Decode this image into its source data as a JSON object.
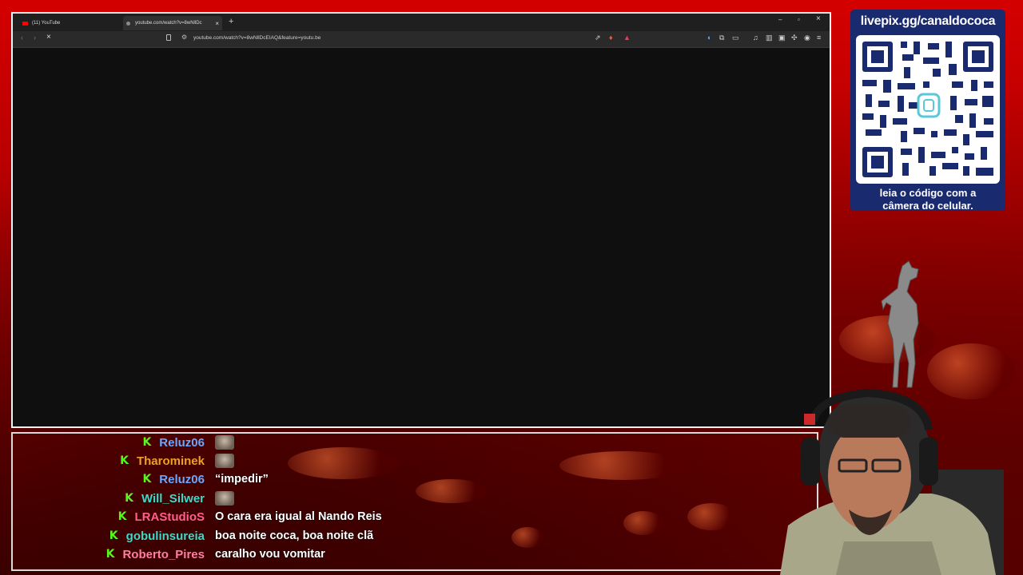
{
  "browser": {
    "tabs": [
      {
        "label": "(11) YouTube",
        "icon": "youtube-icon"
      },
      {
        "label": "youtube.com/watch?v=8wNllDc",
        "icon": "page-icon"
      }
    ],
    "new_tab": "+",
    "window_controls": {
      "minimize": "–",
      "maximize": "▫",
      "close": "×"
    },
    "url": "youtube.com/watch?v=8wNllDcEIAQ&feature=youtu.be"
  },
  "pix": {
    "url": "livepix.gg/canaldococa",
    "caption_line1": "leia o código com a",
    "caption_line2": "câmera do celular."
  },
  "chat": {
    "messages": [
      {
        "user": "Reluz06",
        "color": "#6aa7ff",
        "text": "",
        "emote": true
      },
      {
        "user": "Tharominek",
        "color": "#f0a020",
        "text": "",
        "emote": true
      },
      {
        "user": "Reluz06",
        "color": "#6aa7ff",
        "text": "“impedir”",
        "emote": false
      },
      {
        "user": "Will_Silwer",
        "color": "#3dd9c8",
        "text": "",
        "emote": true
      },
      {
        "user": "LRAStudioS",
        "color": "#ff5f8a",
        "text": "O cara era igual al Nando Reis",
        "emote": false
      },
      {
        "user": "gobulinsureia",
        "color": "#3dd9c8",
        "text": "boa noite coca, boa noite clã",
        "emote": false
      },
      {
        "user": "Roberto_Pires",
        "color": "#ff7fa0",
        "text": "caralho vou vomitar",
        "emote": false
      }
    ]
  },
  "colors": {
    "kick_green": "#53fc18",
    "pix_panel": "#1a2a6e",
    "background_red": "#c00000"
  }
}
